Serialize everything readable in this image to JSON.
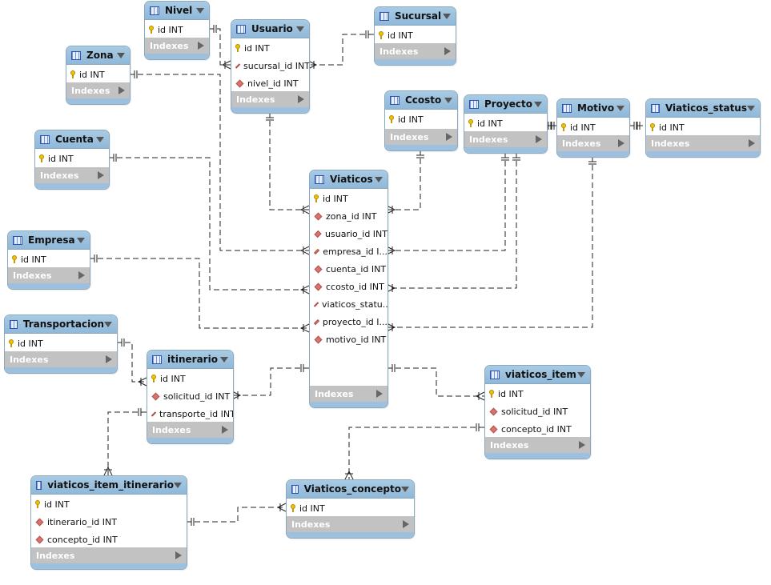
{
  "indexes_label": "Indexes",
  "colors": {
    "header": "#9dc3e0",
    "indexes_bar": "#c2c2c2",
    "primary_key": "#f3c300",
    "foreign_key": "#d9736e",
    "line": "#222222"
  },
  "tables": [
    {
      "id": "nivel",
      "name": "Nivel",
      "columns": [
        {
          "name": "id INT",
          "type": "pk"
        }
      ]
    },
    {
      "id": "usuario",
      "name": "Usuario",
      "columns": [
        {
          "name": "id INT",
          "type": "pk"
        },
        {
          "name": "sucursal_id INT",
          "type": "fk"
        },
        {
          "name": "nivel_id INT",
          "type": "fk"
        }
      ]
    },
    {
      "id": "sucursal",
      "name": "Sucursal",
      "columns": [
        {
          "name": "id INT",
          "type": "pk"
        }
      ]
    },
    {
      "id": "zona",
      "name": "Zona",
      "columns": [
        {
          "name": "id INT",
          "type": "pk"
        }
      ]
    },
    {
      "id": "ccosto",
      "name": "Ccosto",
      "columns": [
        {
          "name": "id INT",
          "type": "pk"
        }
      ]
    },
    {
      "id": "proyecto",
      "name": "Proyecto",
      "columns": [
        {
          "name": "id INT",
          "type": "pk"
        }
      ]
    },
    {
      "id": "motivo",
      "name": "Motivo",
      "columns": [
        {
          "name": "id INT",
          "type": "pk"
        }
      ]
    },
    {
      "id": "viaticos_status",
      "name": "Viaticos_status",
      "columns": [
        {
          "name": "id INT",
          "type": "pk"
        }
      ]
    },
    {
      "id": "cuenta",
      "name": "Cuenta",
      "columns": [
        {
          "name": "id INT",
          "type": "pk"
        }
      ]
    },
    {
      "id": "viaticos",
      "name": "Viaticos",
      "columns": [
        {
          "name": "id INT",
          "type": "pk"
        },
        {
          "name": "zona_id INT",
          "type": "fk"
        },
        {
          "name": "usuario_id INT",
          "type": "fk"
        },
        {
          "name": "empresa_id I...",
          "type": "fk"
        },
        {
          "name": "cuenta_id INT",
          "type": "fk"
        },
        {
          "name": "ccosto_id INT",
          "type": "fk"
        },
        {
          "name": "viaticos_statu...",
          "type": "fk"
        },
        {
          "name": "proyecto_id I...",
          "type": "fk"
        },
        {
          "name": "motivo_id INT",
          "type": "fk"
        }
      ]
    },
    {
      "id": "empresa",
      "name": "Empresa",
      "columns": [
        {
          "name": "id INT",
          "type": "pk"
        }
      ]
    },
    {
      "id": "transportacion",
      "name": "Transportacion",
      "columns": [
        {
          "name": "id INT",
          "type": "pk"
        }
      ]
    },
    {
      "id": "itinerario",
      "name": "itinerario",
      "columns": [
        {
          "name": "id INT",
          "type": "pk"
        },
        {
          "name": "solicitud_id INT",
          "type": "fk"
        },
        {
          "name": "transporte_id INT",
          "type": "fk"
        }
      ]
    },
    {
      "id": "viaticos_item",
      "name": "viaticos_item",
      "columns": [
        {
          "name": "id INT",
          "type": "pk"
        },
        {
          "name": "solicitud_id INT",
          "type": "fk"
        },
        {
          "name": "concepto_id INT",
          "type": "fk"
        }
      ]
    },
    {
      "id": "viaticos_item_itinerario",
      "name": "viaticos_item_itinerario",
      "columns": [
        {
          "name": "id INT",
          "type": "pk"
        },
        {
          "name": "itinerario_id INT",
          "type": "fk"
        },
        {
          "name": "concepto_id INT",
          "type": "fk"
        }
      ]
    },
    {
      "id": "viaticos_concepto",
      "name": "Viaticos_concepto",
      "columns": [
        {
          "name": "id INT",
          "type": "pk"
        }
      ]
    }
  ]
}
